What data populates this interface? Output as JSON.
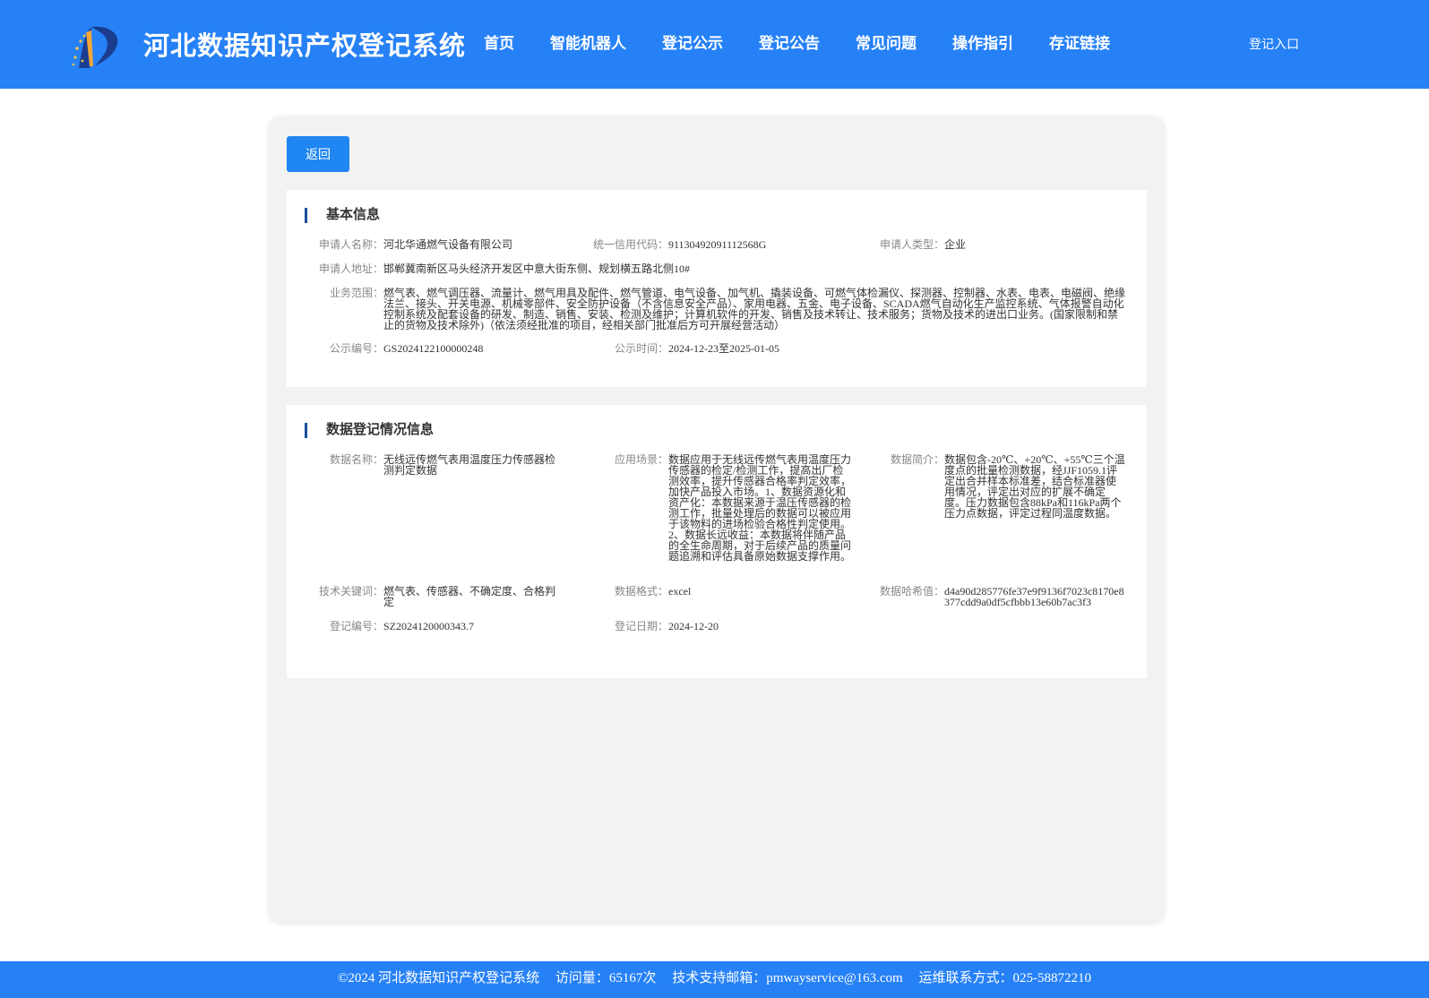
{
  "header": {
    "site_title": "河北数据知识产权登记系统",
    "nav": [
      "首页",
      "智能机器人",
      "登记公示",
      "登记公告",
      "常见问题",
      "操作指引",
      "存证链接"
    ],
    "login": "登记入口",
    "brand_color": "#2681f6"
  },
  "main": {
    "back_label": "返回",
    "basic": {
      "title": "基本信息",
      "applicant_name_label": "申请人名称：",
      "applicant_name": "河北华通燃气设备有限公司",
      "credit_code_label": "统一信用代码：",
      "credit_code": "91130492091112568G",
      "applicant_type_label": "申请人类型：",
      "applicant_type": "企业",
      "address_label": "申请人地址：",
      "address": "邯郸冀南新区马头经济开发区中意大街东侧、规划横五路北侧10#",
      "scope_label": "业务范围：",
      "scope": "燃气表、燃气调压器、流量计、燃气用具及配件、燃气管道、电气设备、加气机、撬装设备、可燃气体检漏仪、探测器、控制器、水表、电表、电磁阀、绝缘法兰、接头、开关电源、机械零部件、安全防护设备（不含信息安全产品）、家用电器、五金、电子设备、SCADA燃气自动化生产监控系统、气体报警自动化控制系统及配套设备的研发、制造、销售、安装、检测及维护；计算机软件的开发、销售及技术转让、技术服务；货物及技术的进出口业务。(国家限制和禁止的货物及技术除外)（依法须经批准的项目，经相关部门批准后方可开展经营活动）",
      "pub_no_label": "公示编号：",
      "pub_no": "GS2024122100000248",
      "pub_time_label": "公示时间：",
      "pub_time": "2024-12-23至2025-01-05"
    },
    "data": {
      "title": "数据登记情况信息",
      "data_name_label": "数据名称：",
      "data_name": "无线远传燃气表用温度压力传感器检测判定数据",
      "scene_label": "应用场景：",
      "scene": "数据应用于无线远传燃气表用温度压力传感器的检定/检测工作，提高出厂检测效率，提升传感器合格率判定效率，加快产品投入市场。1、数据资源化和资产化：本数据来源于温压传感器的检测工作，批量处理后的数据可以被应用于该物料的进场检验合格性判定使用。2、数据长远收益：本数据将伴随产品的全生命周期，对于后续产品的质量问题追溯和评估具备原始数据支撑作用。",
      "intro_label": "数据简介：",
      "intro": "数据包含-20℃、+20℃、+55℃三个温度点的批量检测数据，经JJF1059.1评定出合并样本标准差，结合标准器使用情况，评定出对应的扩展不确定度。压力数据包含88kPa和116kPa两个压力点数据，评定过程同温度数据。",
      "keywords_label": "技术关键词：",
      "keywords": "燃气表、传感器、不确定度、合格判定",
      "format_label": "数据格式：",
      "format": "excel",
      "hash_label": "数据哈希值：",
      "hash": "d4a90d285776fe37e9f9136f7023c8170e8377cdd9a0df5cfbbb13e60b7ac3f3",
      "reg_no_label": "登记编号：",
      "reg_no": "SZ2024120000343.7",
      "reg_date_label": "登记日期：",
      "reg_date": "2024-12-20"
    }
  },
  "footer": {
    "copyright": "©2024 河北数据知识产权登记系统",
    "visits": "访问量：65167次",
    "email": "技术支持邮箱：pmwayservice@163.com",
    "phone": "运维联系方式：025-58872210"
  }
}
